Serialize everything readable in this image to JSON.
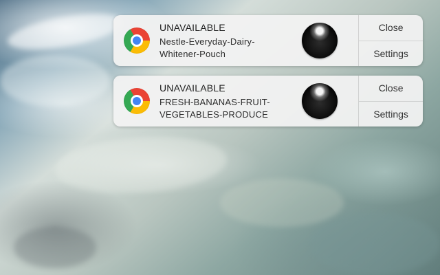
{
  "notifications": [
    {
      "app_icon": "chrome-icon",
      "title": "UNAVAILABLE",
      "body": "Nestle-Everyday-Dairy-\nWhitener-Pouch",
      "actions": {
        "close_label": "Close",
        "settings_label": "Settings"
      }
    },
    {
      "app_icon": "chrome-icon",
      "title": "UNAVAILABLE",
      "body": "FRESH-BANANAS-FRUIT-\nVEGETABLES-PRODUCE",
      "actions": {
        "close_label": "Close",
        "settings_label": "Settings"
      }
    }
  ]
}
